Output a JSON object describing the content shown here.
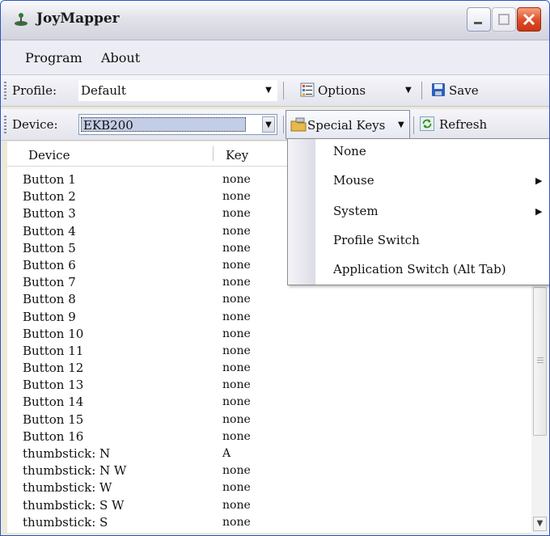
{
  "window": {
    "title": "JoyMapper",
    "icon": "joystick-icon"
  },
  "menubar": {
    "items": [
      "Program",
      "About"
    ]
  },
  "toolbar_profile": {
    "label": "Profile:",
    "value": "Default",
    "options_label": "Options",
    "save_label": "Save"
  },
  "toolbar_device": {
    "label": "Device:",
    "value": "EKB200",
    "special_keys_label": "Special Keys",
    "refresh_label": "Refresh"
  },
  "list": {
    "columns": [
      "Device",
      "Key"
    ],
    "rows": [
      {
        "device": "Button 1",
        "key": "none"
      },
      {
        "device": "Button 2",
        "key": "none"
      },
      {
        "device": "Button 3",
        "key": "none"
      },
      {
        "device": "Button 4",
        "key": "none"
      },
      {
        "device": "Button 5",
        "key": "none"
      },
      {
        "device": "Button 6",
        "key": "none"
      },
      {
        "device": "Button 7",
        "key": "none"
      },
      {
        "device": "Button 8",
        "key": "none"
      },
      {
        "device": "Button 9",
        "key": "none"
      },
      {
        "device": "Button 10",
        "key": "none"
      },
      {
        "device": "Button 11",
        "key": "none"
      },
      {
        "device": "Button 12",
        "key": "none"
      },
      {
        "device": "Button 13",
        "key": "none"
      },
      {
        "device": "Button 14",
        "key": "none"
      },
      {
        "device": "Button 15",
        "key": "none"
      },
      {
        "device": "Button 16",
        "key": "none"
      },
      {
        "device": "thumbstick: N",
        "key": "A"
      },
      {
        "device": "thumbstick: N W",
        "key": "none"
      },
      {
        "device": "thumbstick: W",
        "key": "none"
      },
      {
        "device": "thumbstick: S W",
        "key": "none"
      },
      {
        "device": "thumbstick: S",
        "key": "none"
      }
    ]
  },
  "special_keys_menu": {
    "items": [
      {
        "label": "None",
        "submenu": false
      },
      {
        "label": "Mouse",
        "submenu": true
      },
      {
        "label": "System",
        "submenu": true
      },
      {
        "label": "Profile Switch",
        "submenu": false
      },
      {
        "label": "Application Switch (Alt Tab)",
        "submenu": false
      }
    ]
  },
  "colors": {
    "title_bar": "#e2e2ea",
    "close_button": "#de4b27",
    "selection": "#c4cde6"
  }
}
